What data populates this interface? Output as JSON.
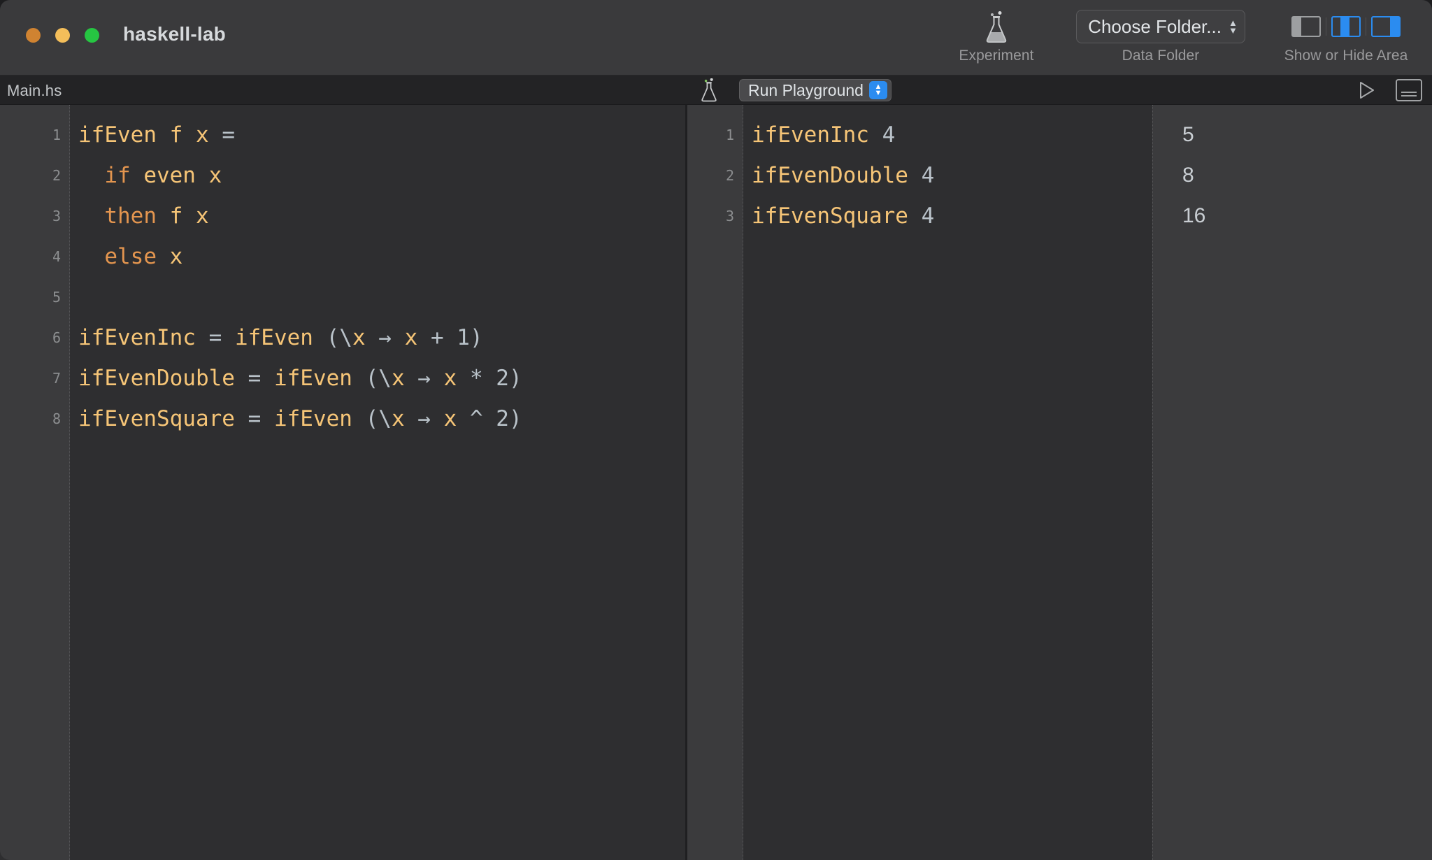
{
  "window": {
    "title": "haskell-lab",
    "traffic_lights": [
      {
        "name": "close",
        "color": "#d08331"
      },
      {
        "name": "minimize",
        "color": "#f4be5a"
      },
      {
        "name": "zoom",
        "color": "#26c642"
      }
    ]
  },
  "toolbar": {
    "experiment": {
      "icon": "flask-icon",
      "label": "Experiment"
    },
    "data_folder": {
      "button_label": "Choose Folder...",
      "group_label": "Data Folder",
      "icon": "chevron-up-down-icon"
    },
    "show_hide_area": {
      "group_label": "Show or Hide Area",
      "buttons": [
        {
          "name": "toggle-left-area",
          "icon": "panel-left-icon",
          "active": false
        },
        {
          "name": "toggle-middle-area",
          "icon": "panel-middle-icon",
          "active": true
        },
        {
          "name": "toggle-right-area",
          "icon": "panel-right-icon",
          "active": true
        }
      ]
    },
    "accent_color": "#2b8cf0"
  },
  "editor_bar": {
    "tab_name": "Main.hs",
    "flask_icon": "flask-icon",
    "run_playground_label": "Run Playground",
    "run_playground_chevron": "chevron-up-down-icon",
    "run_icon": "play-triangle-icon",
    "console_icon": "console-panel-icon"
  },
  "editor": {
    "line_numbers": [
      "1",
      "2",
      "3",
      "4",
      "5",
      "6",
      "7",
      "8"
    ],
    "lines": [
      [
        {
          "t": "ifEven f x ",
          "c": "ident"
        },
        {
          "t": "=",
          "c": "op"
        }
      ],
      [
        {
          "t": "  ",
          "c": "op"
        },
        {
          "t": "if",
          "c": "kw"
        },
        {
          "t": " even x",
          "c": "ident"
        }
      ],
      [
        {
          "t": "  ",
          "c": "op"
        },
        {
          "t": "then",
          "c": "kw"
        },
        {
          "t": " f x",
          "c": "ident"
        }
      ],
      [
        {
          "t": "  ",
          "c": "op"
        },
        {
          "t": "else",
          "c": "kw"
        },
        {
          "t": " x",
          "c": "ident"
        }
      ],
      [
        {
          "t": "",
          "c": "op"
        }
      ],
      [
        {
          "t": "ifEvenInc",
          "c": "ident"
        },
        {
          "t": " = ",
          "c": "op"
        },
        {
          "t": "ifEven",
          "c": "ident"
        },
        {
          "t": " (\\",
          "c": "op"
        },
        {
          "t": "x",
          "c": "ident"
        },
        {
          "t": " → ",
          "c": "op"
        },
        {
          "t": "x",
          "c": "ident"
        },
        {
          "t": " + 1)",
          "c": "op"
        }
      ],
      [
        {
          "t": "ifEvenDouble",
          "c": "ident"
        },
        {
          "t": " = ",
          "c": "op"
        },
        {
          "t": "ifEven",
          "c": "ident"
        },
        {
          "t": " (\\",
          "c": "op"
        },
        {
          "t": "x",
          "c": "ident"
        },
        {
          "t": " → ",
          "c": "op"
        },
        {
          "t": "x",
          "c": "ident"
        },
        {
          "t": " * 2)",
          "c": "op"
        }
      ],
      [
        {
          "t": "ifEvenSquare",
          "c": "ident"
        },
        {
          "t": " = ",
          "c": "op"
        },
        {
          "t": "ifEven",
          "c": "ident"
        },
        {
          "t": " (\\",
          "c": "op"
        },
        {
          "t": "x",
          "c": "ident"
        },
        {
          "t": " → ",
          "c": "op"
        },
        {
          "t": "x",
          "c": "ident"
        },
        {
          "t": " ^ 2)",
          "c": "op"
        }
      ]
    ],
    "plain_text": [
      "ifEven f x =",
      "  if even x",
      "  then f x",
      "  else x",
      "",
      "ifEvenInc = ifEven (\\x → x + 1)",
      "ifEvenDouble = ifEven (\\x → x * 2)",
      "ifEvenSquare = ifEven (\\x → x ^ 2)"
    ]
  },
  "playground": {
    "line_numbers": [
      "1",
      "2",
      "3"
    ],
    "lines": [
      [
        {
          "t": "ifEvenInc",
          "c": "ident"
        },
        {
          "t": " 4",
          "c": "num"
        }
      ],
      [
        {
          "t": "ifEvenDouble",
          "c": "ident"
        },
        {
          "t": " 4",
          "c": "num"
        }
      ],
      [
        {
          "t": "ifEvenSquare",
          "c": "ident"
        },
        {
          "t": " 4",
          "c": "num"
        }
      ]
    ],
    "plain_text": [
      "ifEvenInc 4",
      "ifEvenDouble 4",
      "ifEvenSquare 4"
    ]
  },
  "results": {
    "values": [
      "5",
      "8",
      "16"
    ]
  },
  "colors": {
    "identifier": "#f6c577",
    "keyword": "#e3954f",
    "operator": "#b9c2c9",
    "editor_bg": "#2e2e30",
    "gutter_bg": "#3b3b3d",
    "titlebar_bg": "#3a3a3c",
    "accent": "#2b8cf0"
  }
}
